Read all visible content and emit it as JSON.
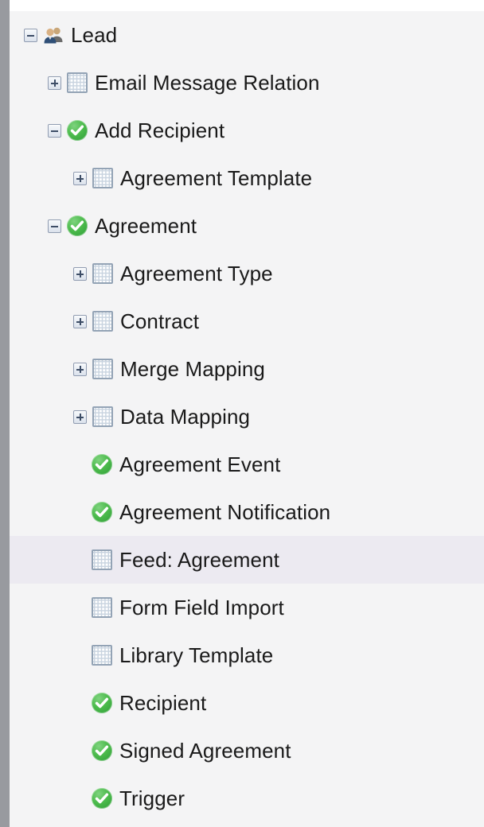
{
  "panel": {
    "background_color": "#F4F4F5",
    "scrollbar_color": "#989A9F",
    "selection_color": "#ECEAF1",
    "text_color": "#1A1A1A"
  },
  "tree": {
    "nodes": [
      {
        "label": "Lead",
        "level": 1,
        "expander": "minus",
        "icon": "people-icon",
        "selected": false
      },
      {
        "label": "Email Message Relation",
        "level": 2,
        "expander": "plus",
        "icon": "grid-icon",
        "selected": false
      },
      {
        "label": "Add Recipient",
        "level": 2,
        "expander": "minus",
        "icon": "green-check-icon",
        "selected": false
      },
      {
        "label": "Agreement Template",
        "level": 3,
        "expander": "plus",
        "icon": "grid-icon",
        "selected": false
      },
      {
        "label": "Agreement",
        "level": 2,
        "expander": "minus",
        "icon": "green-check-icon",
        "selected": false
      },
      {
        "label": "Agreement Type",
        "level": 3,
        "expander": "plus",
        "icon": "grid-icon",
        "selected": false
      },
      {
        "label": "Contract",
        "level": 3,
        "expander": "plus",
        "icon": "grid-icon",
        "selected": false
      },
      {
        "label": "Merge Mapping",
        "level": 3,
        "expander": "plus",
        "icon": "grid-icon",
        "selected": false
      },
      {
        "label": "Data Mapping",
        "level": 3,
        "expander": "plus",
        "icon": "grid-icon",
        "selected": false
      },
      {
        "label": "Agreement Event",
        "level": 3,
        "expander": "none",
        "icon": "green-check-icon",
        "selected": false
      },
      {
        "label": "Agreement Notification",
        "level": 3,
        "expander": "none",
        "icon": "green-check-icon",
        "selected": false
      },
      {
        "label": "Feed: Agreement",
        "level": 3,
        "expander": "none",
        "icon": "grid-icon",
        "selected": true
      },
      {
        "label": "Form Field Import",
        "level": 3,
        "expander": "none",
        "icon": "grid-icon",
        "selected": false
      },
      {
        "label": "Library Template",
        "level": 3,
        "expander": "none",
        "icon": "grid-icon",
        "selected": false
      },
      {
        "label": "Recipient",
        "level": 3,
        "expander": "none",
        "icon": "green-check-icon",
        "selected": false
      },
      {
        "label": "Signed Agreement",
        "level": 3,
        "expander": "none",
        "icon": "green-check-icon",
        "selected": false
      },
      {
        "label": "Trigger",
        "level": 3,
        "expander": "none",
        "icon": "green-check-icon",
        "selected": false
      }
    ]
  }
}
